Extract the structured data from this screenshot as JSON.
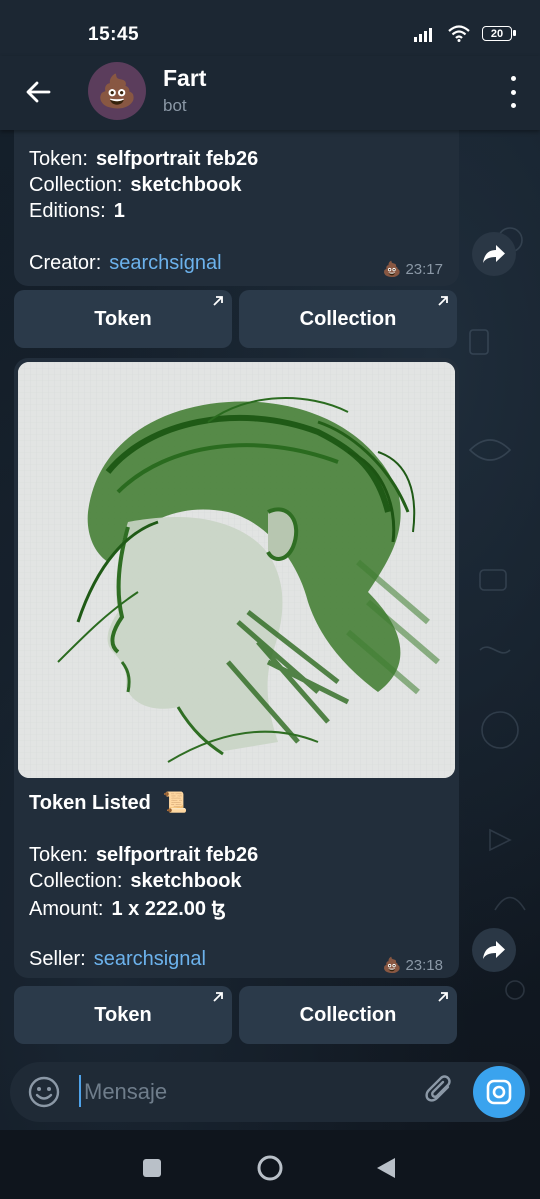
{
  "status_bar": {
    "time": "15:45",
    "battery": "20",
    "icons": [
      "signal-icon",
      "wifi-icon",
      "battery-icon"
    ]
  },
  "header": {
    "title": "Fart",
    "subtitle": "bot",
    "avatar_emoji": "💩",
    "icons": [
      "back-arrow-icon",
      "more-vertical-icon"
    ]
  },
  "messages": [
    {
      "token_label": "Token:",
      "token_value": "selfportrait feb26",
      "collection_label": "Collection:",
      "collection_value": "sketchbook",
      "editions_label": "Editions:",
      "editions_value": "1",
      "creator_label": "Creator:",
      "creator_value": "searchsignal",
      "meta_emoji": "💩",
      "time": "23:17",
      "buttons": {
        "token": "Token",
        "collection": "Collection"
      }
    },
    {
      "heading": "Token Listed",
      "heading_emoji": "📜",
      "token_label": "Token:",
      "token_value": "selfportrait feb26",
      "collection_label": "Collection:",
      "collection_value": "sketchbook",
      "amount_label": "Amount:",
      "amount_value": "1 x 222.00 ꜩ",
      "seller_label": "Seller:",
      "seller_value": "searchsignal",
      "meta_emoji": "💩",
      "time": "23:18",
      "buttons": {
        "token": "Token",
        "collection": "Collection"
      }
    }
  ],
  "composer": {
    "placeholder": "Mensaje"
  },
  "colors": {
    "accent": "#3aa3ee",
    "link": "#6cb2ec",
    "bubble": "#222e3b",
    "inline_button": "#2b3a4a",
    "sketch_green": "#2f6e23"
  }
}
